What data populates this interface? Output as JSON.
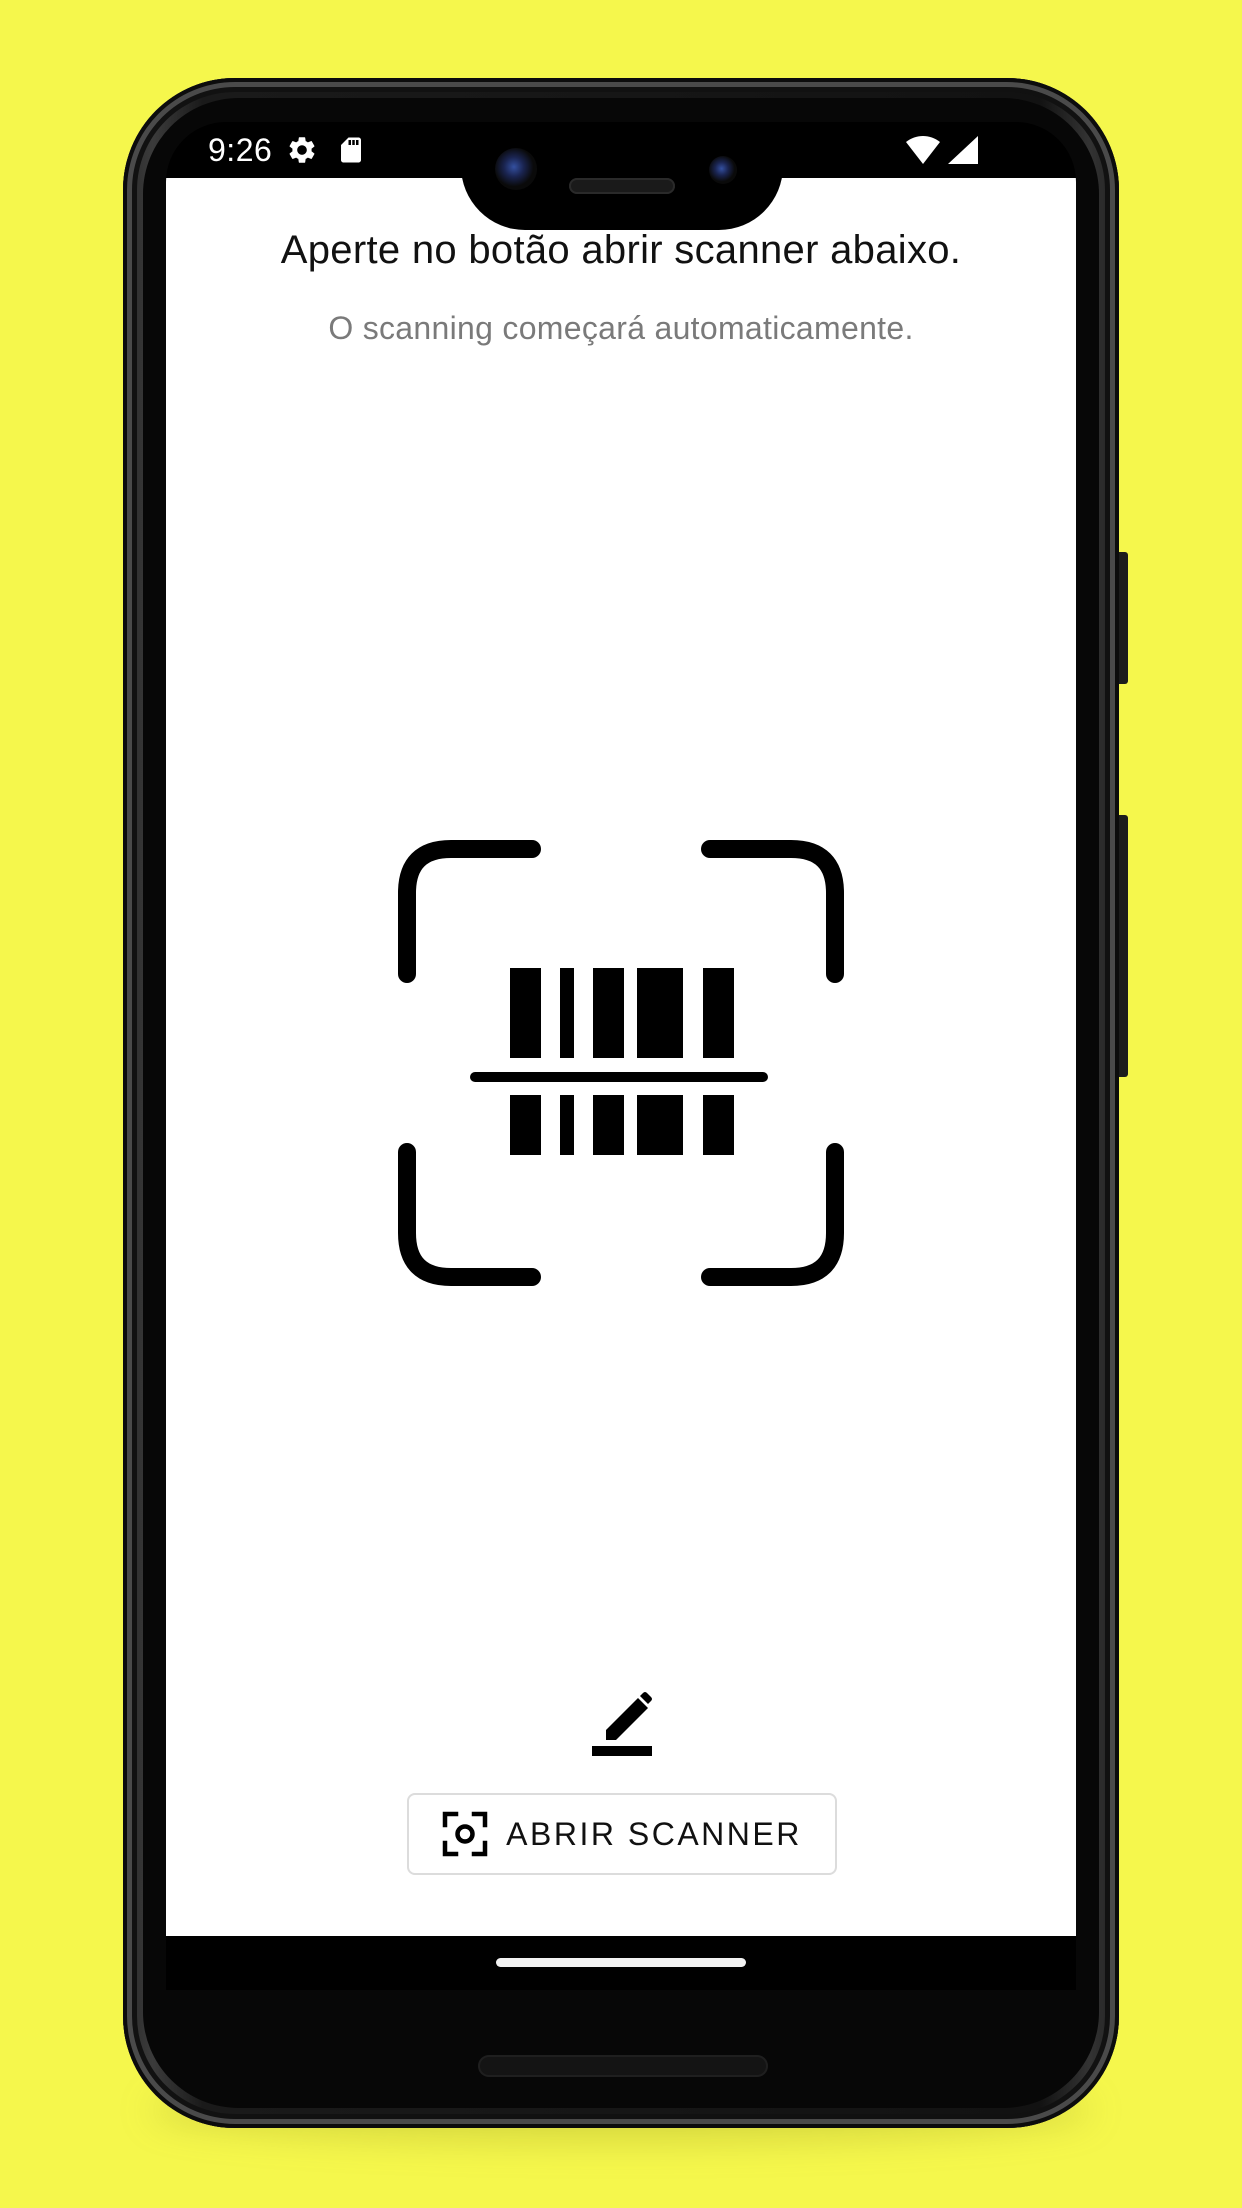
{
  "status_bar": {
    "time": "9:26",
    "left_icons": [
      "gear-icon",
      "sd-card-icon"
    ],
    "right_icons": [
      "wifi-icon",
      "signal-icon"
    ]
  },
  "main": {
    "title": "Aperte no botão abrir scanner abaixo.",
    "subtitle": "O scanning começará automaticamente.",
    "illustration": "barcode-scan-icon",
    "edit_icon": "edit-pencil-icon",
    "scan_button": {
      "icon": "camera-focus-icon",
      "label": "ABRIR SCANNER"
    }
  },
  "colors": {
    "background": "#f5f74c",
    "screen": "#ffffff",
    "title_text": "#111111",
    "subtitle_text": "#7a7a7a",
    "button_border": "#dcdcdc"
  }
}
